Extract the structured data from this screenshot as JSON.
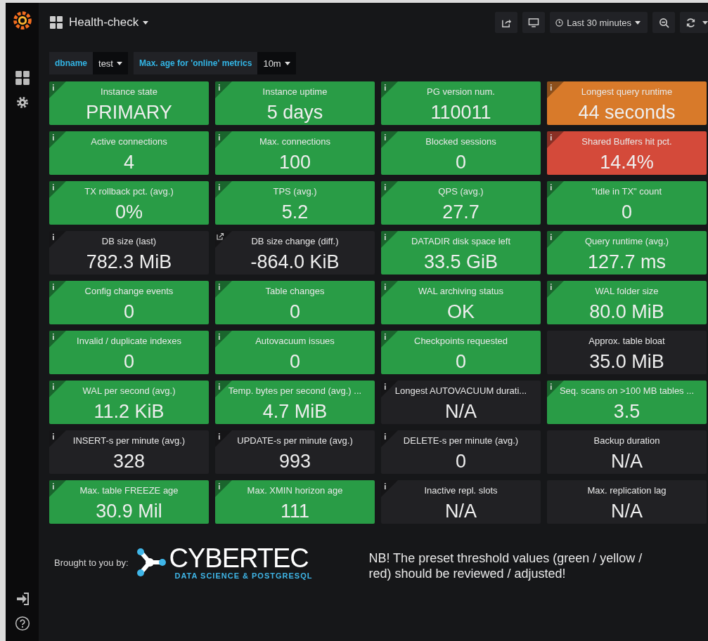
{
  "dashboard": {
    "title": "Health-check"
  },
  "toolbar": {
    "time_range": "Last 30 minutes"
  },
  "variables": [
    {
      "label": "dbname",
      "value": "test"
    },
    {
      "label": "Max. age for 'online' metrics",
      "value": "10m"
    }
  ],
  "panels": [
    {
      "title": "Instance state",
      "value": "PRIMARY",
      "color": "#299c46",
      "info_icon": true,
      "link_icon": false
    },
    {
      "title": "Instance uptime",
      "value": "5 days",
      "color": "#299c46",
      "info_icon": true,
      "link_icon": false
    },
    {
      "title": "PG version num.",
      "value": "110011",
      "color": "#299c46",
      "info_icon": true,
      "link_icon": false
    },
    {
      "title": "Longest query runtime",
      "value": "44 seconds",
      "color": "#d87a2a",
      "info_icon": true,
      "link_icon": false
    },
    {
      "title": "Active connections",
      "value": "4",
      "color": "#299c46",
      "info_icon": true,
      "link_icon": false
    },
    {
      "title": "Max. connections",
      "value": "100",
      "color": "#299c46",
      "info_icon": true,
      "link_icon": false
    },
    {
      "title": "Blocked sessions",
      "value": "0",
      "color": "#299c46",
      "info_icon": true,
      "link_icon": false
    },
    {
      "title": "Shared Buffers hit pct.",
      "value": "14.4%",
      "color": "#d44a3a",
      "info_icon": true,
      "link_icon": false
    },
    {
      "title": "TX rollback pct. (avg.)",
      "value": "0%",
      "color": "#299c46",
      "info_icon": true,
      "link_icon": false
    },
    {
      "title": "TPS (avg.)",
      "value": "5.2",
      "color": "#299c46",
      "info_icon": true,
      "link_icon": false
    },
    {
      "title": "QPS (avg.)",
      "value": "27.7",
      "color": "#299c46",
      "info_icon": true,
      "link_icon": false
    },
    {
      "title": "\"Idle in TX\" count",
      "value": "0",
      "color": "#299c46",
      "info_icon": true,
      "link_icon": false
    },
    {
      "title": "DB size (last)",
      "value": "782.3 MiB",
      "color": "#212124",
      "info_icon": true,
      "link_icon": false
    },
    {
      "title": "DB size change (diff.)",
      "value": "-864.0 KiB",
      "color": "#212124",
      "info_icon": false,
      "link_icon": true
    },
    {
      "title": "DATADIR disk space left",
      "value": "33.5 GiB",
      "color": "#299c46",
      "info_icon": true,
      "link_icon": false
    },
    {
      "title": "Query runtime (avg.)",
      "value": "127.7 ms",
      "color": "#299c46",
      "info_icon": true,
      "link_icon": false
    },
    {
      "title": "Config change events",
      "value": "0",
      "color": "#299c46",
      "info_icon": true,
      "link_icon": false
    },
    {
      "title": "Table changes",
      "value": "0",
      "color": "#299c46",
      "info_icon": true,
      "link_icon": false
    },
    {
      "title": "WAL archiving status",
      "value": "OK",
      "color": "#299c46",
      "info_icon": true,
      "link_icon": false
    },
    {
      "title": "WAL folder size",
      "value": "80.0 MiB",
      "color": "#299c46",
      "info_icon": true,
      "link_icon": false
    },
    {
      "title": "Invalid / duplicate indexes",
      "value": "0",
      "color": "#299c46",
      "info_icon": true,
      "link_icon": false
    },
    {
      "title": "Autovacuum issues",
      "value": "0",
      "color": "#299c46",
      "info_icon": true,
      "link_icon": false
    },
    {
      "title": "Checkpoints requested",
      "value": "0",
      "color": "#299c46",
      "info_icon": true,
      "link_icon": false
    },
    {
      "title": "Approx. table bloat",
      "value": "35.0 MiB",
      "color": "#212124",
      "info_icon": false,
      "link_icon": false
    },
    {
      "title": "WAL per second (avg.)",
      "value": "11.2 KiB",
      "color": "#299c46",
      "info_icon": true,
      "link_icon": false
    },
    {
      "title": "Temp. bytes per second (avg.) ...",
      "value": "4.7 MiB",
      "color": "#299c46",
      "info_icon": true,
      "link_icon": false
    },
    {
      "title": "Longest AUTOVACUUM durati...",
      "value": "N/A",
      "color": "#212124",
      "info_icon": true,
      "link_icon": false
    },
    {
      "title": "Seq. scans on >100 MB tables ...",
      "value": "3.5",
      "color": "#299c46",
      "info_icon": true,
      "link_icon": false
    },
    {
      "title": "INSERT-s per minute (avg.)",
      "value": "328",
      "color": "#212124",
      "info_icon": true,
      "link_icon": false
    },
    {
      "title": "UPDATE-s per minute (avg.)",
      "value": "993",
      "color": "#212124",
      "info_icon": true,
      "link_icon": false
    },
    {
      "title": "DELETE-s per minute (avg.)",
      "value": "0",
      "color": "#212124",
      "info_icon": true,
      "link_icon": false
    },
    {
      "title": "Backup duration",
      "value": "N/A",
      "color": "#212124",
      "info_icon": false,
      "link_icon": false
    },
    {
      "title": "Max. table FREEZE age",
      "value": "30.9 Mil",
      "color": "#299c46",
      "info_icon": true,
      "link_icon": false
    },
    {
      "title": "Max. XMIN horizon age",
      "value": "111",
      "color": "#299c46",
      "info_icon": true,
      "link_icon": false
    },
    {
      "title": "Inactive repl. slots",
      "value": "N/A",
      "color": "#212124",
      "info_icon": true,
      "link_icon": false
    },
    {
      "title": "Max. replication lag",
      "value": "N/A",
      "color": "#212124",
      "info_icon": false,
      "link_icon": false
    }
  ],
  "footer": {
    "credit": "Brought to you by:",
    "logo_name": "CYBERTEC",
    "logo_tagline": "DATA SCIENCE & POSTGRESQL",
    "note": "NB! The preset threshold values (green / yellow / red) should be reviewed / adjusted!"
  }
}
